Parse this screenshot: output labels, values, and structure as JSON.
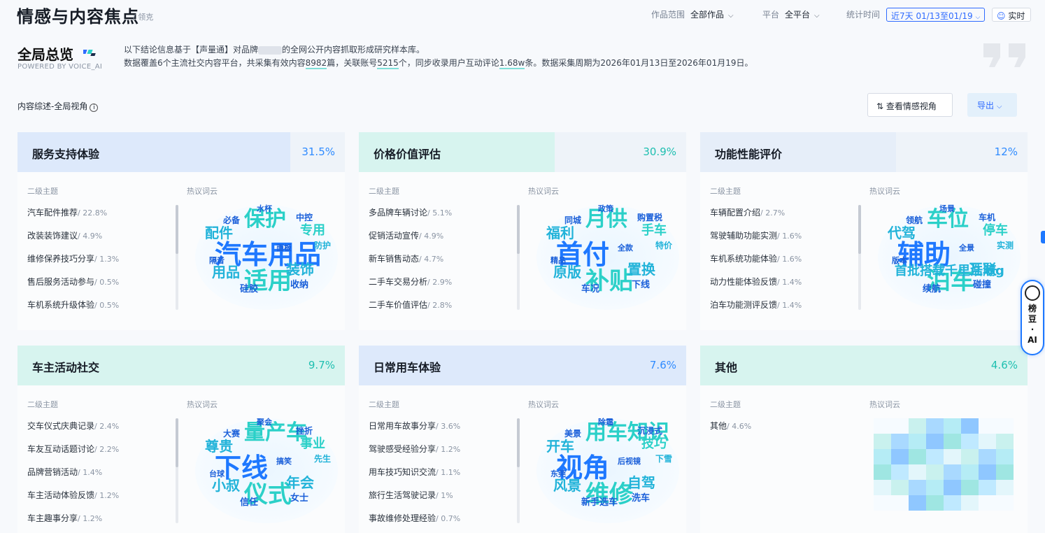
{
  "header": {
    "title": "情感与内容焦点",
    "crumb": "/ 领克",
    "scope_label": "作品范围",
    "scope_value": "全部作品",
    "platform_label": "平台",
    "platform_value": "全平台",
    "time_label": "统计时间",
    "time_range": "近7天  01/13至01/19",
    "realtime_label": "实时"
  },
  "overview": {
    "title": "全局总览",
    "powered_by": "POWERED BY VOICE_AI",
    "line1_prefix": "以下结论信息基于【声量通】对品牌",
    "line1_suffix": "的全网公开内容抓取形成研究样本库。",
    "line2_a": "数据覆盖6个主流社交内容平台，共采集有效内容",
    "content_count": "8982",
    "line2_b": "篇，关联账号",
    "account_count": "5215",
    "line2_c": "个，同步收录用户互动评论",
    "comment_count": "1.68w",
    "line2_d": "条。数据采集周期为2026年01月13日至2026年01月19日。"
  },
  "content_header": {
    "label": "内容综述-全局视角",
    "view_button": "查看情感视角",
    "export_button": "导出"
  },
  "columns": {
    "sub_topic": "二级主题",
    "word_cloud": "热议词云"
  },
  "colors": {
    "accent": "#2f6bff",
    "teal": "#2bd0c8",
    "pct_blue": "#2f8bff",
    "pct_teal": "#1fbfb0"
  },
  "cards": [
    {
      "title": "服务支持体验",
      "pct": "31.5%",
      "share": 0.315,
      "subtopics": [
        {
          "name": "汽车配件推荐",
          "share": "/ 22.8%"
        },
        {
          "name": "改装装饰建议",
          "share": "/ 4.9%"
        },
        {
          "name": "维修保养技巧分享",
          "share": "/ 1.3%"
        },
        {
          "name": "售后服务活动参与",
          "share": "/ 0.5%"
        },
        {
          "name": "车机系统升级体验",
          "share": "/ 0.5%"
        }
      ],
      "words": [
        "汽车用品",
        "保护",
        "适用",
        "配件",
        "专用",
        "装饰",
        "用品",
        "收纳",
        "中控",
        "必备",
        "隔音",
        "水杯",
        "硅胶",
        "面板",
        "防护"
      ]
    },
    {
      "title": "价格价值评估",
      "pct": "30.9%",
      "share": 0.309,
      "subtopics": [
        {
          "name": "多品牌车辆讨论",
          "share": "/ 5.1%"
        },
        {
          "name": "促销活动宣传",
          "share": "/ 4.9%"
        },
        {
          "name": "新车销售动态",
          "share": "/ 4.7%"
        },
        {
          "name": "二手车交易分析",
          "share": "/ 2.9%"
        },
        {
          "name": "二手车价值评估",
          "share": "/ 2.8%"
        }
      ],
      "words": [
        "首付",
        "月供",
        "补贴",
        "福利",
        "手车",
        "置换",
        "原版",
        "下线",
        "购置税",
        "同城",
        "精品",
        "政策",
        "车况",
        "全款",
        "特价"
      ]
    },
    {
      "title": "功能性能评价",
      "pct": "12%",
      "share": 0.12,
      "subtopics": [
        {
          "name": "车辆配置介绍",
          "share": "/ 2.7%"
        },
        {
          "name": "驾驶辅助功能实测",
          "share": "/ 1.6%"
        },
        {
          "name": "车机系统功能体验",
          "share": "/ 1.6%"
        },
        {
          "name": "动力性能体验反馈",
          "share": "/ 1.4%"
        },
        {
          "name": "泊车功能测评反馈",
          "share": "/ 1.4%"
        }
      ],
      "words": [
        "辅助",
        "车位",
        "泊车",
        "代驾",
        "停车",
        "互联",
        "首批搭载千里浩瀚g",
        "碰撞",
        "车机",
        "领航",
        "版本",
        "场景",
        "续航",
        "全景",
        "实测"
      ]
    },
    {
      "title": "车主活动社交",
      "pct": "9.7%",
      "share": 0.097,
      "subtopics": [
        {
          "name": "交车仪式庆典记录",
          "share": "/ 2.4%"
        },
        {
          "name": "车友互动话题讨论",
          "share": "/ 2.2%"
        },
        {
          "name": "品牌营销活动",
          "share": "/ 1.4%"
        },
        {
          "name": "车主活动体验反馈",
          "share": "/ 1.2%"
        },
        {
          "name": "车主趣事分享",
          "share": "/ 1.2%"
        }
      ],
      "words": [
        "下线",
        "量产车",
        "仪式",
        "尊贵",
        "事业",
        "年会",
        "小叔",
        "女士",
        "挫折",
        "大赛",
        "台球",
        "聚会",
        "信任",
        "搞笑",
        "先生"
      ]
    },
    {
      "title": "日常用车体验",
      "pct": "7.6%",
      "share": 0.076,
      "subtopics": [
        {
          "name": "日常用车故事分享",
          "share": "/ 3.6%"
        },
        {
          "name": "驾驶感受经验分享",
          "share": "/ 1.2%"
        },
        {
          "name": "用车技巧知识交流",
          "share": "/ 1.1%"
        },
        {
          "name": "旅行生活驾驶记录",
          "share": "/ 1%"
        },
        {
          "name": "事故维修处理经验",
          "share": "/ 0.7%"
        }
      ],
      "words": [
        "视角",
        "用车知识",
        "维修",
        "开车",
        "技巧",
        "自驾",
        "风景",
        "洗车",
        "沉浸式",
        "美景",
        "东莞",
        "除霜",
        "新手选车",
        "后视镜",
        "下雪"
      ]
    },
    {
      "title": "其他",
      "pct": "4.6%",
      "share": 0.046,
      "subtopics": [
        {
          "name": "其他",
          "share": "/ 4.6%"
        }
      ],
      "words": []
    }
  ],
  "ai_assistant": {
    "label1": "榜",
    "label2": "豆",
    "dot": "·",
    "label3": "AI"
  }
}
